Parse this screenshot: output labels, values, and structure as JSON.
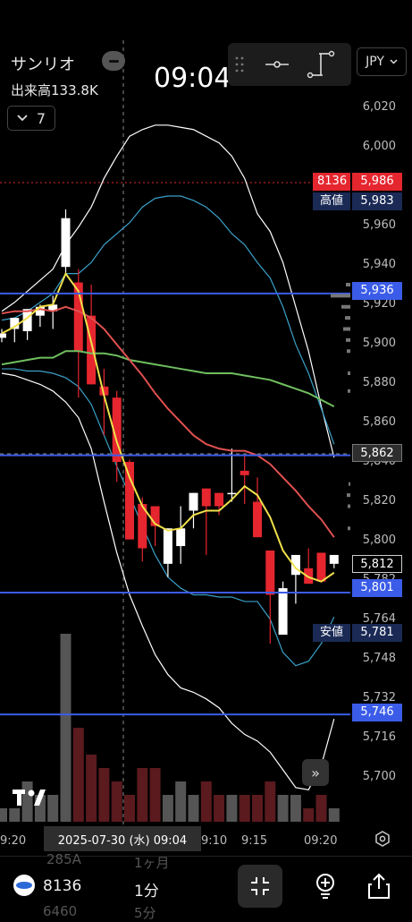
{
  "header": {
    "company": "サンリオ",
    "volume_label": "出来高133.8K",
    "period_value": "7",
    "time": "09:04",
    "currency": "JPY"
  },
  "price_tags": {
    "last_code": "8136",
    "last_price": "5,986",
    "high_label": "高値",
    "high_price": "5,983",
    "low_label": "安値",
    "low_price": "5,781",
    "line1": "5,936",
    "crosshair": "5,862",
    "current": "5,812",
    "line2": "5,801",
    "line3": "5,746"
  },
  "date_box": "2025-07-30 (水)  09:04",
  "bottom": {
    "code": "8136",
    "interval": "1分",
    "ghost1": "285A",
    "ghost2": "1ヶ月",
    "ghost3": "6460",
    "ghost4": "5分"
  },
  "colors": {
    "up": "#ffffff",
    "down": "#e5262f",
    "ma_short": "#f0e04a",
    "ma_mid": "#e05050",
    "ma_long": "#6fbf5f",
    "bb_inner": "#3aa0c8",
    "bb_outer": "#ffffff",
    "hline": "#3b5ce8",
    "panel": "#1a2a55"
  },
  "chart_data": {
    "type": "candlestick",
    "y_ticks": [
      "6,020",
      "6,000",
      "5,980",
      "5,960",
      "5,940",
      "5,920",
      "5,900",
      "5,880",
      "5,860",
      "5,840",
      "5,820",
      "5,800",
      "5,782",
      "5,764",
      "5,748",
      "5,732",
      "5,716",
      "5,700"
    ],
    "x_ticks": [
      "9:20",
      "9:10",
      "9:15",
      "09:20"
    ],
    "candles": [
      {
        "o": 5916,
        "h": 5920,
        "l": 5914,
        "c": 5918
      },
      {
        "o": 5920,
        "h": 5922,
        "l": 5914,
        "c": 5925
      },
      {
        "o": 5919,
        "h": 5929,
        "l": 5915,
        "c": 5929
      },
      {
        "o": 5926,
        "h": 5931,
        "l": 5921,
        "c": 5930
      },
      {
        "o": 5928,
        "h": 5935,
        "l": 5920,
        "c": 5931
      },
      {
        "o": 5948,
        "h": 5974,
        "l": 5945,
        "c": 5970
      },
      {
        "o": 5941,
        "h": 5947,
        "l": 5889,
        "c": 5910
      },
      {
        "o": 5926,
        "h": 5940,
        "l": 5896,
        "c": 5895
      },
      {
        "o": 5894,
        "h": 5902,
        "l": 5872,
        "c": 5890
      },
      {
        "o": 5889,
        "h": 5892,
        "l": 5851,
        "c": 5860
      },
      {
        "o": 5860,
        "h": 5861,
        "l": 5832,
        "c": 5825
      },
      {
        "o": 5841,
        "h": 5844,
        "l": 5815,
        "c": 5821
      },
      {
        "o": 5840,
        "h": 5840,
        "l": 5822,
        "c": 5831
      },
      {
        "o": 5814,
        "h": 5830,
        "l": 5808,
        "c": 5830
      },
      {
        "o": 5822,
        "h": 5840,
        "l": 5814,
        "c": 5830
      },
      {
        "o": 5838,
        "h": 5842,
        "l": 5830,
        "c": 5846
      },
      {
        "o": 5848,
        "h": 5845,
        "l": 5818,
        "c": 5840
      },
      {
        "o": 5846,
        "h": 5846,
        "l": 5836,
        "c": 5840
      },
      {
        "o": 5846,
        "h": 5866,
        "l": 5842,
        "c": 5846
      },
      {
        "o": 5856,
        "h": 5863,
        "l": 5841,
        "c": 5854
      },
      {
        "o": 5842,
        "h": 5853,
        "l": 5830,
        "c": 5826
      },
      {
        "o": 5820,
        "h": 5820,
        "l": 5778,
        "c": 5800
      },
      {
        "o": 5782,
        "h": 5806,
        "l": 5782,
        "c": 5803
      },
      {
        "o": 5809,
        "h": 5815,
        "l": 5796,
        "c": 5818
      },
      {
        "o": 5812,
        "h": 5821,
        "l": 5808,
        "c": 5805
      },
      {
        "o": 5819,
        "h": 5816,
        "l": 5806,
        "c": 5806
      },
      {
        "o": 5814,
        "h": 5816,
        "l": 5812,
        "c": 5818
      }
    ],
    "volumes": [
      1,
      1,
      3,
      2,
      2,
      14,
      7,
      5,
      4,
      3,
      2,
      4,
      4,
      2,
      3,
      2,
      3,
      2,
      2,
      2,
      2,
      3,
      2,
      2,
      1,
      2,
      1
    ],
    "ma_short": [
      5918,
      5921,
      5925,
      5930,
      5931,
      5945,
      5937,
      5914,
      5890,
      5869,
      5853,
      5840,
      5832,
      5829,
      5830,
      5836,
      5838,
      5838,
      5843,
      5849,
      5845,
      5835,
      5820,
      5812,
      5808,
      5806,
      5810
    ],
    "ma_mid": [
      5927,
      5928,
      5928,
      5929,
      5928,
      5930,
      5928,
      5925,
      5920,
      5913,
      5906,
      5899,
      5891,
      5884,
      5878,
      5872,
      5868,
      5866,
      5865,
      5865,
      5863,
      5859,
      5853,
      5847,
      5840,
      5834,
      5826
    ],
    "ma_long": [
      5904,
      5905,
      5906,
      5907,
      5907,
      5910,
      5910,
      5909,
      5909,
      5908,
      5906,
      5905,
      5904,
      5903,
      5902,
      5901,
      5900,
      5900,
      5900,
      5899,
      5898,
      5897,
      5895,
      5893,
      5891,
      5888,
      5885
    ],
    "bb_upper_inner": [
      5924,
      5925,
      5928,
      5932,
      5936,
      5945,
      5945,
      5950,
      5958,
      5963,
      5968,
      5975,
      5979,
      5980,
      5980,
      5978,
      5975,
      5970,
      5963,
      5958,
      5950,
      5943,
      5930,
      5913,
      5900,
      5884,
      5868
    ],
    "bb_lower_inner": [
      5902,
      5902,
      5901,
      5901,
      5900,
      5898,
      5894,
      5886,
      5872,
      5858,
      5845,
      5831,
      5818,
      5808,
      5803,
      5800,
      5800,
      5799,
      5799,
      5797,
      5797,
      5789,
      5774,
      5768,
      5770,
      5778,
      5790
    ],
    "bb_upper_outer": [
      5928,
      5932,
      5937,
      5942,
      5947,
      5958,
      5966,
      5975,
      5988,
      5998,
      6007,
      6010,
      6012,
      6012,
      6011,
      6010,
      6007,
      6004,
      5998,
      5988,
      5972,
      5964,
      5950,
      5930,
      5910,
      5885,
      5862
    ],
    "bb_lower_outer": [
      5900,
      5899,
      5897,
      5895,
      5892,
      5887,
      5880,
      5866,
      5842,
      5819,
      5800,
      5786,
      5773,
      5764,
      5758,
      5756,
      5753,
      5749,
      5742,
      5737,
      5734,
      5729,
      5721,
      5713,
      5712,
      5723,
      5744
    ],
    "h_lines": [
      5936,
      5863,
      5801,
      5746
    ],
    "high_line": 5986
  }
}
